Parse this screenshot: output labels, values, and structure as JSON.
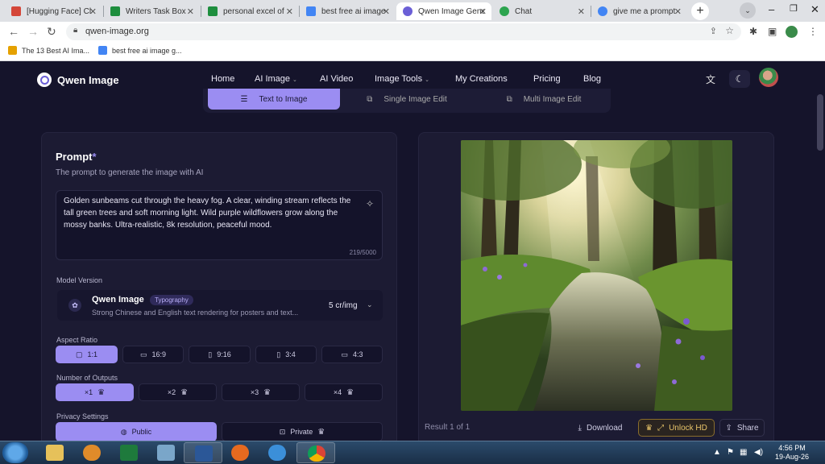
{
  "browser": {
    "tabs": [
      {
        "title": "[Hugging Face] Cl",
        "color": "#d44638"
      },
      {
        "title": "Writers Task Box",
        "color": "#1e8e3e"
      },
      {
        "title": "personal excel of",
        "color": "#1e8e3e"
      },
      {
        "title": "best free ai image",
        "color": "#4285f4"
      },
      {
        "title": "Qwen Image Gene",
        "color": "#6b5fd6"
      },
      {
        "title": "Chat",
        "color": "#2ca44f"
      },
      {
        "title": "give me a prompt",
        "color": "#4285f4"
      }
    ],
    "new_tab": "+",
    "url": "qwen-image.org",
    "bookmarks": [
      {
        "label": "The 13 Best AI Ima...",
        "color": "#e5a100"
      },
      {
        "label": "best free ai image g...",
        "color": "#4285f4"
      }
    ]
  },
  "site": {
    "brand": "Qwen Image",
    "nav": [
      {
        "label": "Home",
        "caret": false
      },
      {
        "label": "AI Image",
        "caret": true
      },
      {
        "label": "AI Video",
        "caret": false
      },
      {
        "label": "Image Tools",
        "caret": true
      },
      {
        "label": "My Creations",
        "caret": false
      },
      {
        "label": "Pricing",
        "caret": false
      },
      {
        "label": "Blog",
        "caret": false
      }
    ],
    "modes": [
      "Text to Image",
      "Single Image Edit",
      "Multi Image Edit"
    ]
  },
  "prompt": {
    "title": "Prompt",
    "required_mark": "*",
    "subtitle": "The prompt to generate the image with AI",
    "text": "Golden sunbeams cut through the heavy fog. A clear, winding stream reflects the tall green trees and soft morning light. Wild purple wildflowers grow along the mossy banks. Ultra-realistic, 8k resolution, peaceful mood.",
    "count": "219/5000"
  },
  "model": {
    "label": "Model Version",
    "name": "Qwen Image",
    "tag": "Typography",
    "description": "Strong Chinese and English text rendering for posters and text...",
    "cost": "5 cr/img"
  },
  "aspect": {
    "label": "Aspect Ratio",
    "options": [
      "1:1",
      "16:9",
      "9:16",
      "3:4",
      "4:3"
    ]
  },
  "outputs": {
    "label": "Number of Outputs",
    "options": [
      "×1",
      "×2",
      "×3",
      "×4"
    ]
  },
  "privacy": {
    "label": "Privacy Settings",
    "options": [
      "Public",
      "Private"
    ]
  },
  "result": {
    "label": "Result 1 of 1",
    "download": "Download",
    "unlock": "Unlock HD",
    "share": "Share"
  },
  "taskbar": {
    "time": "4:56 PM",
    "date": "19-Aug-26"
  },
  "colors": {
    "accent": "#9b8df2",
    "background": "#15142b",
    "panel": "#1c1b33"
  }
}
